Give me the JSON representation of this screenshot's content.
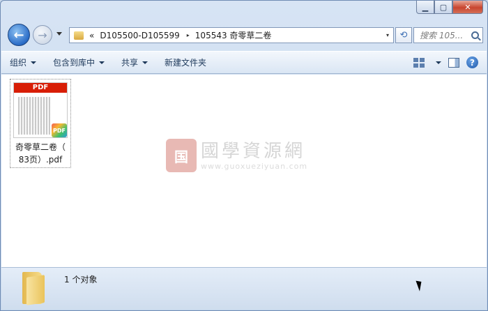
{
  "window": {
    "caption": {
      "minimize": "▁",
      "maximize": "▢",
      "close": "✕"
    }
  },
  "nav": {
    "back_glyph": "←",
    "forward_glyph": "→",
    "address": {
      "overflow": "«",
      "segments": [
        "D105500-D105599",
        "105543 奇零草二卷"
      ],
      "separator": "▸",
      "dropdown": "▾"
    },
    "refresh_glyph": "⟲",
    "search_placeholder": "搜索 105..."
  },
  "toolbar": {
    "organize": "组织",
    "include_library": "包含到库中",
    "share": "共享",
    "new_folder": "新建文件夹",
    "help": "?"
  },
  "files": [
    {
      "name_line1": "奇零草二卷（",
      "name_line2": "83页）.pdf",
      "thumb_band": "PDF",
      "thumb_badge": "PDF"
    }
  ],
  "watermark": {
    "seal": "国",
    "title": "國學資源網",
    "url": "www.guoxueziyuan.com"
  },
  "status": {
    "count": "1 个对象"
  }
}
